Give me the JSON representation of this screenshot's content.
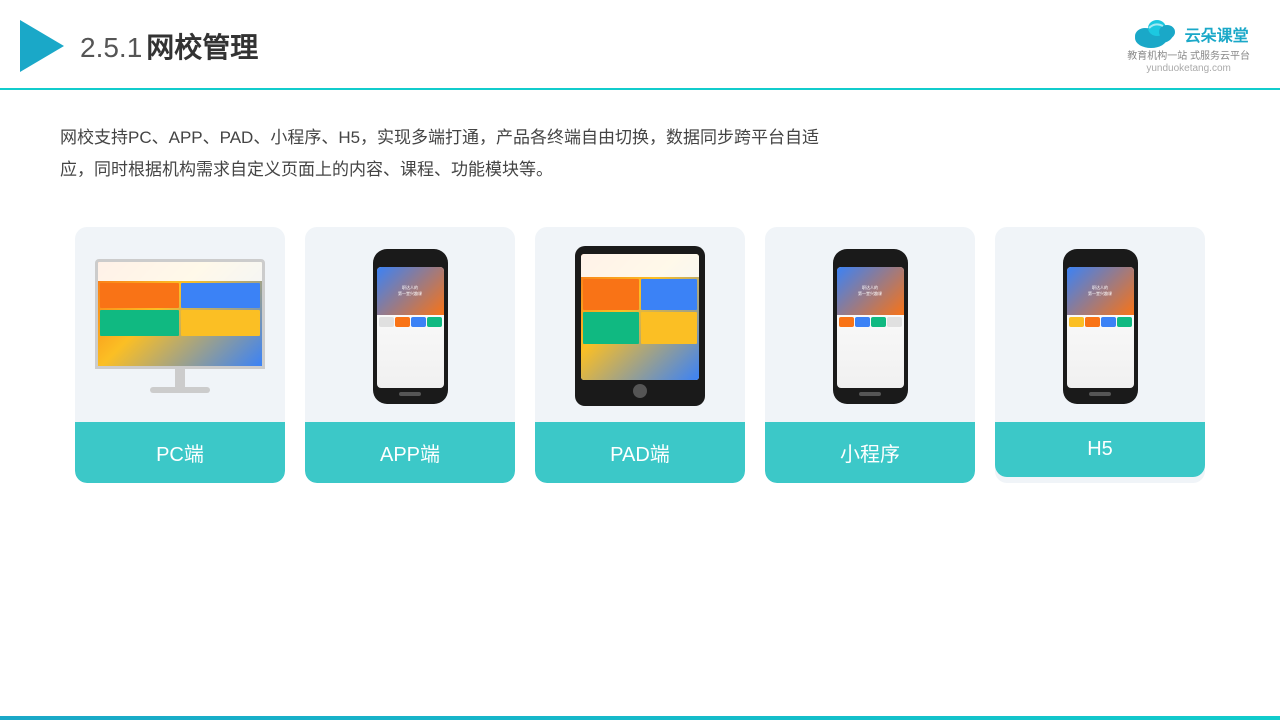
{
  "header": {
    "title_num": "2.5.1",
    "title_text": "网校管理",
    "logo_main": "云朵课堂",
    "logo_url": "yunduoketang.com",
    "logo_sub": "教育机构一站\n式服务云平台"
  },
  "description": {
    "text": "网校支持PC、APP、PAD、小程序、H5，实现多端打通，产品各终端自由切换，数据同步跨平台自适应，同时根据机构需求自定义页面上的内容、课程、功能模块等。"
  },
  "cards": [
    {
      "id": "pc",
      "label": "PC端"
    },
    {
      "id": "app",
      "label": "APP端"
    },
    {
      "id": "pad",
      "label": "PAD端"
    },
    {
      "id": "miniapp",
      "label": "小程序"
    },
    {
      "id": "h5",
      "label": "H5"
    }
  ],
  "accent_color": "#3cc8c8"
}
